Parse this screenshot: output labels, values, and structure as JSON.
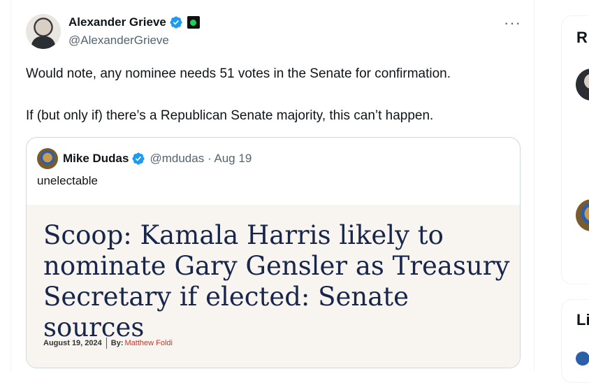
{
  "tweet": {
    "display_name": "Alexander Grieve",
    "handle": "@AlexanderGrieve",
    "more_label": "···",
    "paragraphs": [
      "Would note, any nominee needs 51 votes in the Senate for confirmation.",
      "If (but only if) there’s a Republican Senate majority, this can’t happen."
    ]
  },
  "quote": {
    "display_name": "Mike Dudas",
    "handle_date": "@mdudas · Aug 19",
    "text": "unelectable",
    "article": {
      "headline": "Scoop: Kamala Harris likely to nominate Gary Gensler as Treasury Secretary if elected: Senate sources",
      "date": "August 19, 2024",
      "by_label": "By:",
      "author": "Matthew Foldi"
    }
  },
  "sidebar": {
    "card1_title": "R",
    "card2_title": "Li"
  },
  "colors": {
    "verified_blue": "#1d9bf0",
    "headline_navy": "#17264a",
    "author_red": "#c0392b",
    "secondary_text": "#536471"
  },
  "icons": [
    "verified-badge-icon",
    "affiliate-badge-icon",
    "more-options-icon"
  ]
}
